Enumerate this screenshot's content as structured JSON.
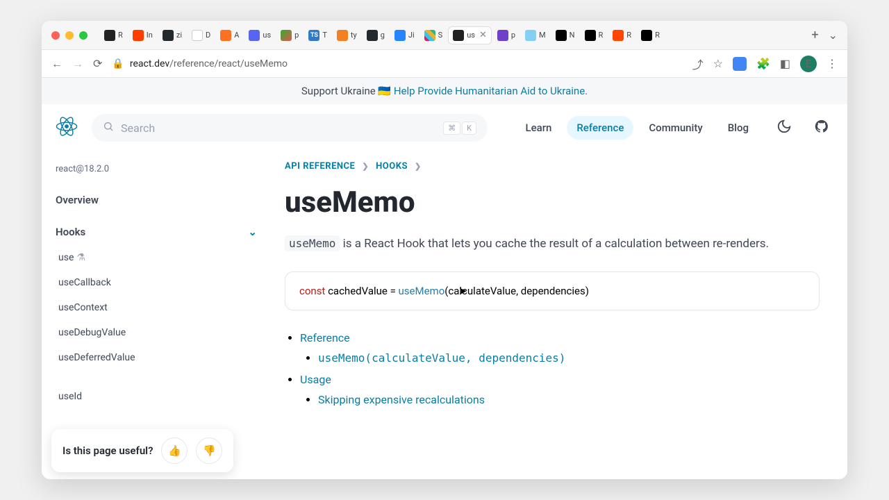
{
  "browser": {
    "tabs": [
      {
        "fav": "react",
        "label": "R"
      },
      {
        "fav": "svelte",
        "label": "In"
      },
      {
        "fav": "github",
        "label": "zi"
      },
      {
        "fav": "wiki",
        "label": "D"
      },
      {
        "fav": "blender",
        "label": "A"
      },
      {
        "fav": "pan",
        "label": "us"
      },
      {
        "fav": "pw",
        "label": "p"
      },
      {
        "fav": "ts",
        "label": "T"
      },
      {
        "fav": "so",
        "label": "ty"
      },
      {
        "fav": "github",
        "label": "g"
      },
      {
        "fav": "jira",
        "label": "Ji"
      },
      {
        "fav": "slack",
        "label": "S"
      },
      {
        "fav": "react",
        "label": "us",
        "active": true
      },
      {
        "fav": "gp",
        "label": "p"
      },
      {
        "fav": "mdn",
        "label": "M"
      },
      {
        "fav": "nx",
        "label": "N"
      },
      {
        "fav": "remix",
        "label": "R"
      },
      {
        "fav": "reddit",
        "label": "R"
      },
      {
        "fav": "torch",
        "label": "R"
      }
    ],
    "url_domain": "react.dev",
    "url_path": "/reference/react/useMemo",
    "avatar_letter": "E"
  },
  "banner": {
    "prefix": "Support Ukraine 🇺🇦 ",
    "link": "Help Provide Humanitarian Aid to Ukraine."
  },
  "nav": {
    "search_placeholder": "Search",
    "kbd1": "⌘",
    "kbd2": "K",
    "links": [
      "Learn",
      "Reference",
      "Community",
      "Blog"
    ],
    "active_link": "Reference"
  },
  "sidebar": {
    "version": "react@18.2.0",
    "overview": "Overview",
    "section": "Hooks",
    "items": [
      "use",
      "useCallback",
      "useContext",
      "useDebugValue",
      "useDeferredValue",
      "",
      "useId"
    ]
  },
  "article": {
    "crumb1": "API REFERENCE",
    "crumb2": "HOOKS",
    "title": "useMemo",
    "desc_code": "useMemo",
    "desc_rest": " is a React Hook that lets you cache the result of a calculation between re-renders.",
    "code_kw": "const",
    "code_var": " cachedValue = ",
    "code_fn": "useMemo",
    "code_args": "(calculateValue, dependencies)",
    "toc": {
      "ref": "Reference",
      "ref_sig": "useMemo(calculateValue, dependencies)",
      "usage": "Usage",
      "usage1": "Skipping expensive recalculations"
    }
  },
  "feedback": {
    "question": "Is this page useful?"
  }
}
